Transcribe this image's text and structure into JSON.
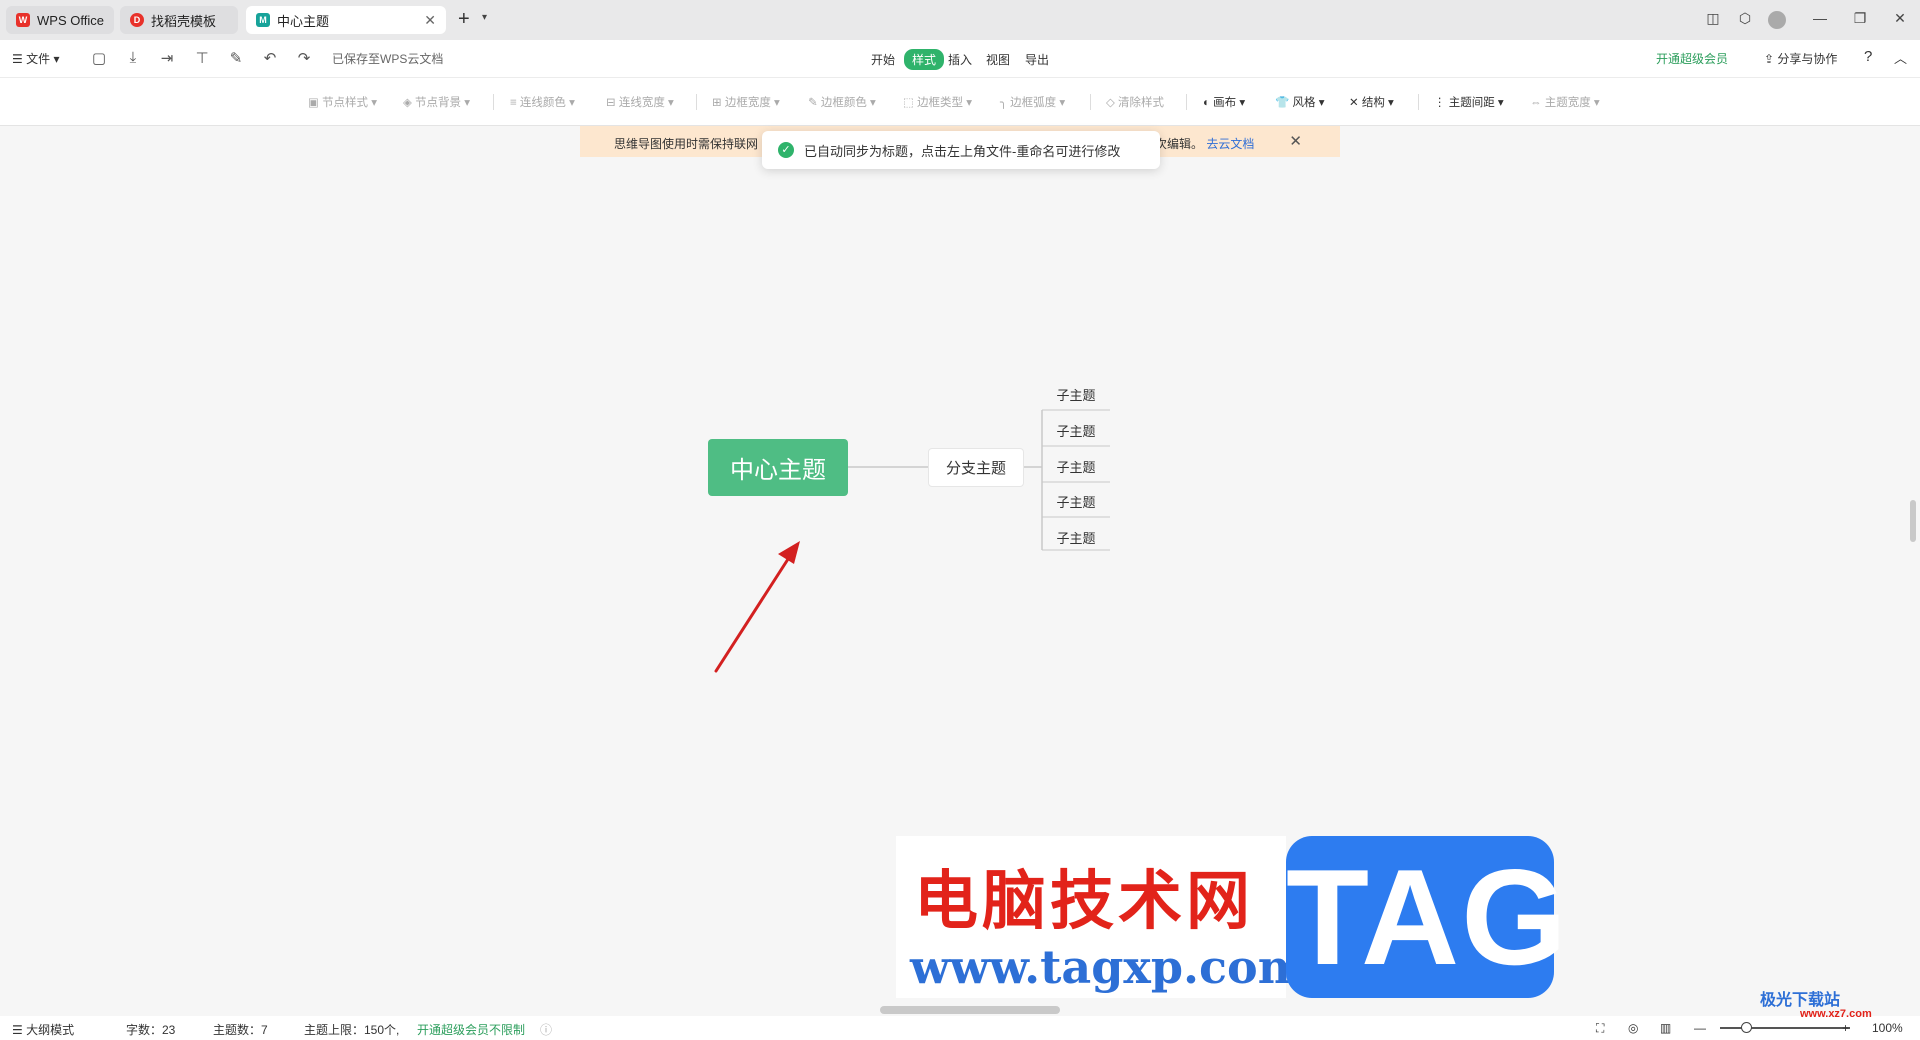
{
  "tabs": {
    "wps": {
      "label": "WPS Office",
      "icon": "wps-logo-icon"
    },
    "template": {
      "label": "找稻壳模板",
      "icon": "daoke-icon"
    },
    "mind": {
      "label": "中心主题",
      "icon": "mindmap-icon"
    }
  },
  "menubar": {
    "file": "文件",
    "saved_status": "已保存至WPS云文档",
    "tabs": [
      "开始",
      "样式",
      "插入",
      "视图",
      "导出"
    ],
    "active_tab": "样式",
    "vip": "开通超级会员",
    "share": "分享与协作"
  },
  "stylebar": {
    "items": [
      "节点样式",
      "节点背景",
      "连线颜色",
      "连线宽度",
      "边框宽度",
      "边框颜色",
      "边框类型",
      "边框弧度",
      "清除样式",
      "画布",
      "风格",
      "结构",
      "主题间距",
      "主题宽度"
    ]
  },
  "notice": {
    "left_text": "思维导图使用时需保持联网",
    "right_text": "次编辑。",
    "link": "去云文档"
  },
  "toast": {
    "text": "已自动同步为标题，点击左上角文件-重命名可进行修改"
  },
  "mindmap": {
    "center": "中心主题",
    "branch": "分支主题",
    "subtopics": [
      "子主题",
      "子主题",
      "子主题",
      "子主题",
      "子主题"
    ]
  },
  "watermark": {
    "title": "电脑技术网",
    "url": "www.tagxp.com",
    "tag": "TAG",
    "corner_logo": "极光下载站",
    "corner_url": "www.xz7.com"
  },
  "statusbar": {
    "outline": "大纲模式",
    "word_count": "字数：23",
    "topic_count": "主题数：7",
    "topic_limit": "主题上限：150个,",
    "topic_unlimited": "开通超级会员不限制",
    "zoom": "100%"
  },
  "colors": {
    "accent": "#2fb36b",
    "center_node": "#4fbd84",
    "notice_bg": "#fde7cf",
    "arrow": "#d32020"
  }
}
